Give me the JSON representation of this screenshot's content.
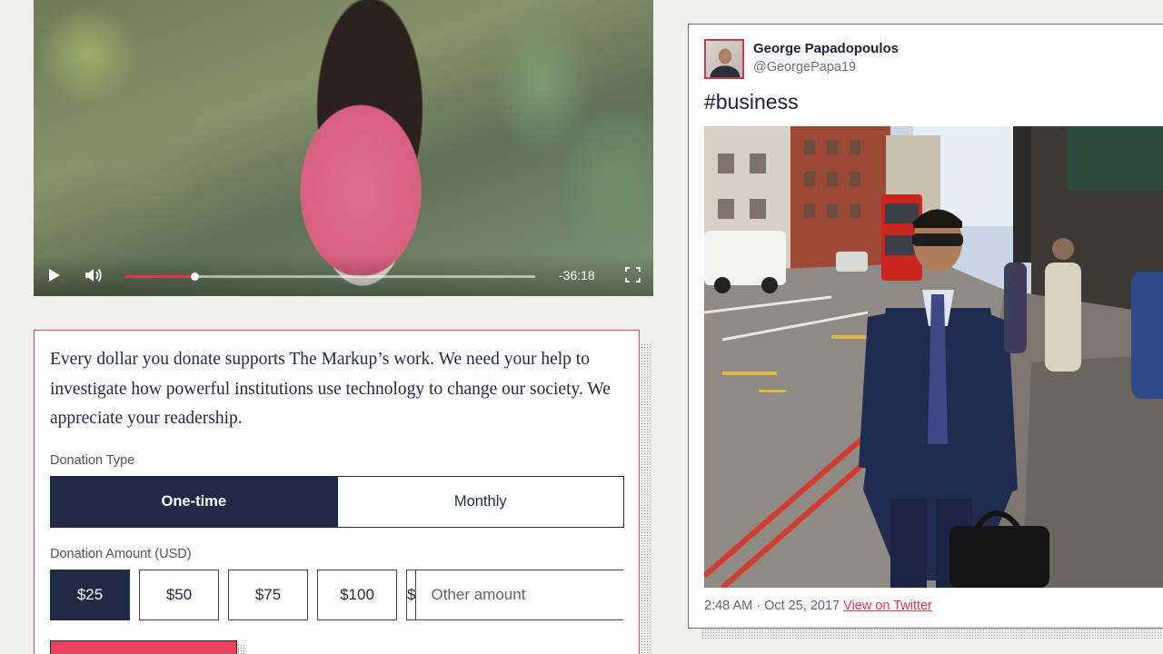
{
  "video": {
    "time_remaining": "-36:18",
    "progress": 0.17,
    "icons": [
      "play-icon",
      "volume-icon",
      "fullscreen-icon"
    ],
    "accent": "#e2364f"
  },
  "donate": {
    "intro": "Every dollar you donate supports The Markup’s work. We need your help to investigate how powerful institutions use technology to change our society. We appreciate your readership.",
    "type_label": "Donation Type",
    "type_options": [
      "One-time",
      "Monthly"
    ],
    "type_selected": "One-time",
    "amount_label": "Donation Amount (USD)",
    "amounts": [
      "$25",
      "$50",
      "$75",
      "$100"
    ],
    "amount_selected": "$25",
    "currency_symbol": "$",
    "other_placeholder": "Other amount",
    "border_color": "#e2485f",
    "primary_color": "#1f2a44"
  },
  "tweet": {
    "author_name": "George Papadopoulos",
    "author_handle": "@GeorgePapa19",
    "text": "#business",
    "timestamp": "2:48 AM · Oct 25, 2017",
    "link_text": "View on Twitter"
  }
}
